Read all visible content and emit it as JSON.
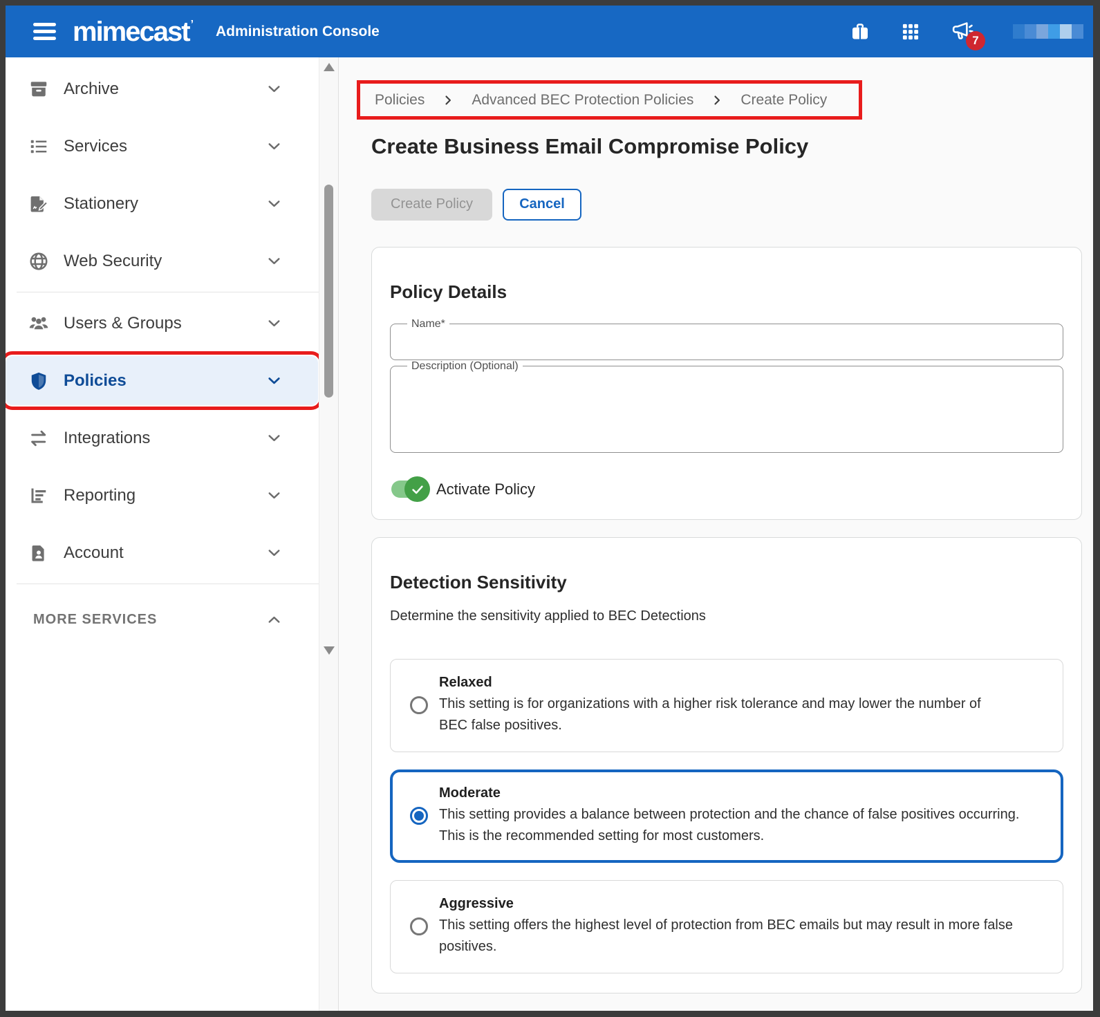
{
  "colors": {
    "topbar_blue": "#1768c3",
    "accent_blue": "#1565c0",
    "active_nav_blue": "#0f4c97",
    "annotation_red": "#e81c1c",
    "toggle_green": "#43a047",
    "toggle_track_green": "#85c88a",
    "notification_badge_red": "#cf2730"
  },
  "topbar": {
    "logo_text": "mimecast",
    "app_title": "Administration Console",
    "notification_count": "7"
  },
  "sidebar": {
    "items": [
      {
        "label": "Archive",
        "active": false
      },
      {
        "label": "Services",
        "active": false
      },
      {
        "label": "Stationery",
        "active": false
      },
      {
        "label": "Web Security",
        "active": false
      },
      {
        "label": "Users & Groups",
        "active": false
      },
      {
        "label": "Policies",
        "active": true
      },
      {
        "label": "Integrations",
        "active": false
      },
      {
        "label": "Reporting",
        "active": false
      },
      {
        "label": "Account",
        "active": false
      }
    ],
    "more_services_label": "MORE SERVICES"
  },
  "breadcrumb": {
    "items": [
      "Policies",
      "Advanced BEC Protection Policies",
      "Create Policy"
    ]
  },
  "page": {
    "title": "Create Business Email Compromise Policy"
  },
  "actions": {
    "create_label": "Create Policy",
    "cancel_label": "Cancel"
  },
  "policy_details": {
    "heading": "Policy Details",
    "name_label": "Name*",
    "name_value": "",
    "description_label": "Description (Optional)",
    "description_value": "",
    "activate_label": "Activate Policy",
    "activate_on": true
  },
  "detection": {
    "heading": "Detection Sensitivity",
    "subtitle": "Determine the sensitivity applied to BEC Detections",
    "options": [
      {
        "label": "Relaxed",
        "description": "This setting is for organizations with a higher risk tolerance and may lower the number of BEC false positives.",
        "selected": false
      },
      {
        "label": "Moderate",
        "description": "This setting provides a balance between protection and the chance of false positives occurring. This is the recommended setting for most customers.",
        "selected": true
      },
      {
        "label": "Aggressive",
        "description": "This setting offers the highest level of protection from BEC emails but may result in more false positives.",
        "selected": false
      }
    ]
  }
}
